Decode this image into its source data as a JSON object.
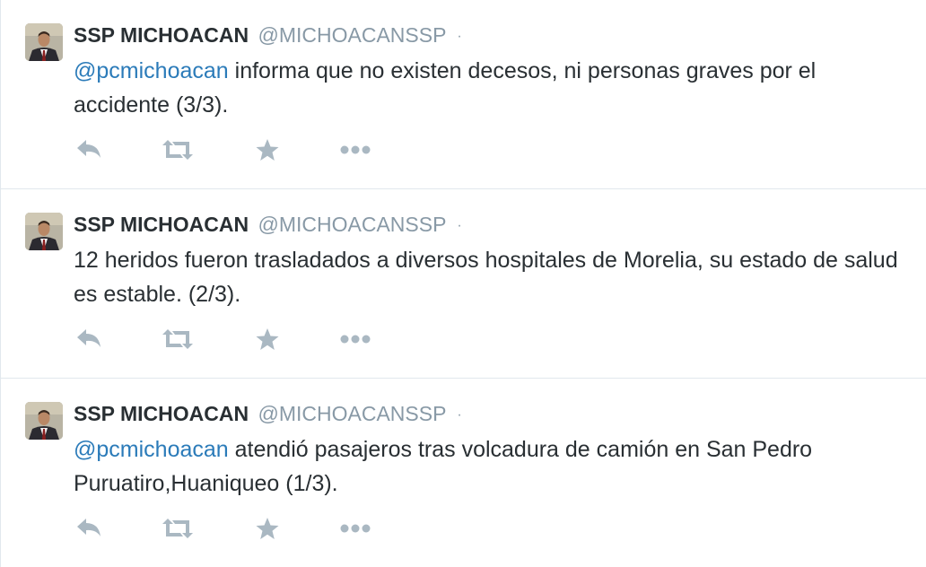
{
  "colors": {
    "name": "#292f33",
    "handle": "#8899a6",
    "mention": "#2b7bb9",
    "icon": "#aab8c2",
    "divider": "#e1e8ed"
  },
  "tweets": [
    {
      "author": {
        "fullname": "SSP MICHOACAN",
        "username": "@MICHOACANSSP",
        "separator": "·"
      },
      "mention": "@pcmichoacan",
      "text": " informa que no existen decesos, ni personas graves por el accidente (3/3).",
      "actions": [
        "reply-icon",
        "retweet-icon",
        "favorite-star-icon",
        "more-dots-icon"
      ]
    },
    {
      "author": {
        "fullname": "SSP MICHOACAN",
        "username": "@MICHOACANSSP",
        "separator": "·"
      },
      "mention": "",
      "text": "12 heridos fueron trasladados a diversos hospitales de Morelia, su estado de salud es estable. (2/3).",
      "actions": [
        "reply-icon",
        "retweet-icon",
        "favorite-star-icon",
        "more-dots-icon"
      ]
    },
    {
      "author": {
        "fullname": "SSP MICHOACAN",
        "username": "@MICHOACANSSP",
        "separator": "·"
      },
      "mention": "@pcmichoacan",
      "text": " atendió pasajeros tras volcadura de camión en San Pedro Puruatiro,Huaniqueo (1/3).",
      "actions": [
        "reply-icon",
        "retweet-icon",
        "favorite-star-icon",
        "more-dots-icon"
      ]
    }
  ]
}
